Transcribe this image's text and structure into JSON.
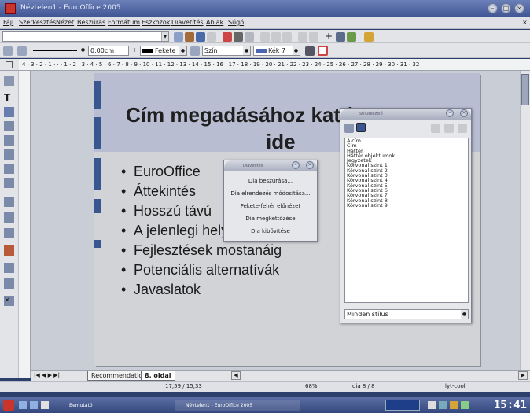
{
  "window": {
    "title": "Névtelen1 - EuroOffice 2005"
  },
  "menubar": [
    "Fájl",
    "Szerkesztés",
    "Nézet",
    "Beszúrás",
    "Formátum",
    "Eszközök",
    "Diavetítés",
    "Ablak",
    "Súgó"
  ],
  "toolbar": {
    "line_width": "0,00cm",
    "line_color": "Fekete",
    "fill_type": "Szín",
    "fill_color": "Kék 7"
  },
  "hruler_text": "4 · 3 · 2 · 1 · · · 1 · 2 · 3 · 4 · 5 · 6 · 7 · 8 · 9 · 10 · 11 · 12 · 13 · 14 · 15 · 16 · 17 · 18 · 19 · 20 · 21 · 22 · 23 · 24 · 25 · 26 · 27 · 28 · 29 · 30 · 31 · 32",
  "slide": {
    "title_line1": "Cím megadásához kattintson",
    "title_line2": "ide",
    "bullets": [
      "EuroOffice",
      "Áttekintés",
      "Hosszú távú",
      "A jelenlegi helyzet",
      "Fejlesztések mostanáig",
      "Potenciális alternatívák",
      "Javaslatok"
    ],
    "bullet_char": "•"
  },
  "slide_menu": {
    "title": "Diavetítés",
    "items": [
      "Dia beszúrása...",
      "Dia elrendezés módosítása...",
      "Fekete-fehér előnézet",
      "Dia megkettőzése",
      "Dia kibővítése"
    ]
  },
  "stylist": {
    "title": "Stíluskezelő",
    "styles": [
      "Alcím",
      "Cím",
      "Háttér",
      "Háttér objektumok",
      "Jegyzetek",
      "Körvonal szint 1",
      "Körvonal szint 2",
      "Körvonal szint 3",
      "Körvonal szint 4",
      "Körvonal szint 5",
      "Körvonal szint 6",
      "Körvonal szint 7",
      "Körvonal szint 8",
      "Körvonal szint 9"
    ],
    "filter": "Minden stílus"
  },
  "tabs": {
    "recommendation": "Recommendation",
    "active": "8. oldal"
  },
  "status": {
    "position": "17,59 / 15,33",
    "zoom": "68%",
    "slide": "dia 8 / 8",
    "layout": "lyt-cool"
  },
  "taskbar": {
    "task1": "Bemutató",
    "task2": "Névtelen1 - EuroOffice 2005",
    "clock": "15:41"
  },
  "colors": {
    "slide_accent": "#3a5690",
    "title_band": "#b9bdd2"
  }
}
